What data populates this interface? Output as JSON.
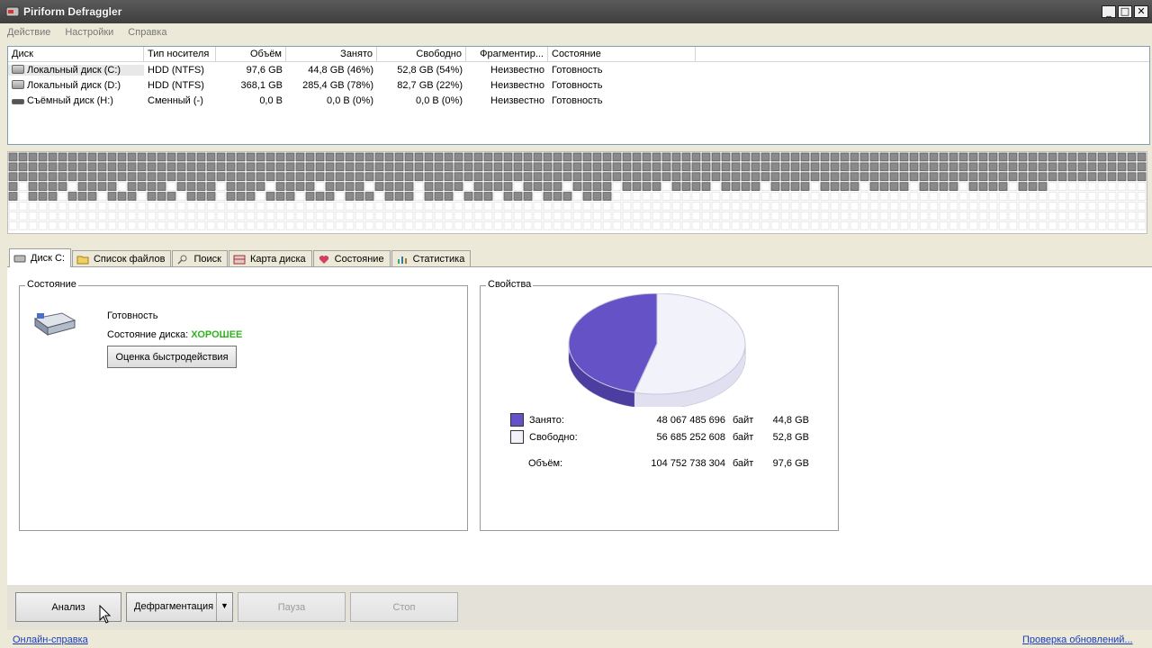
{
  "window": {
    "title": "Piriform Defraggler",
    "minimize": "_",
    "maximize": "□",
    "close": "✕"
  },
  "menu": [
    "Действие",
    "Настройки",
    "Справка"
  ],
  "drive_table": {
    "columns": [
      "Диск",
      "Тип носителя",
      "Объём",
      "Занято",
      "Свободно",
      "Фрагментир...",
      "Состояние"
    ],
    "rows": [
      {
        "icon": "hdd-icon",
        "name": "Локальный диск (C:)",
        "media": "HDD (NTFS)",
        "size": "97,6 GB",
        "used": "44,8 GB (46%)",
        "free": "52,8 GB (54%)",
        "frag": "Неизвестно",
        "state": "Готовность",
        "selected": true
      },
      {
        "icon": "hdd-icon",
        "name": "Локальный диск (D:)",
        "media": "HDD (NTFS)",
        "size": "368,1 GB",
        "used": "285,4 GB (78%)",
        "free": "82,7 GB (22%)",
        "frag": "Неизвестно",
        "state": "Готовность",
        "selected": false
      },
      {
        "icon": "removable-drive-icon",
        "name": "Съёмный диск (H:)",
        "media": "Сменный (-)",
        "size": "0,0 B",
        "used": "0,0 B (0%)",
        "free": "0,0 B (0%)",
        "frag": "Неизвестно",
        "state": "Готовность",
        "selected": false
      }
    ]
  },
  "tabs": [
    {
      "label": "Диск C:",
      "icon": "hdd-icon",
      "active": true
    },
    {
      "label": "Список файлов",
      "icon": "folder-icon",
      "active": false
    },
    {
      "label": "Поиск",
      "icon": "search-icon",
      "active": false
    },
    {
      "label": "Карта диска",
      "icon": "map-icon",
      "active": false
    },
    {
      "label": "Состояние",
      "icon": "health-icon",
      "active": false
    },
    {
      "label": "Статистика",
      "icon": "stats-icon",
      "active": false
    }
  ],
  "status_panel": {
    "legend": "Состояние",
    "ready": "Готовность",
    "health_label": "Состояние диска:",
    "health_value": "ХОРОШЕЕ",
    "benchmark_button": "Оценка быстродействия"
  },
  "properties_panel": {
    "legend": "Свойства",
    "used_label": "Занято:",
    "used_bytes": "48 067 485 696",
    "used_unit": "байт",
    "used_size": "44,8 GB",
    "free_label": "Свободно:",
    "free_bytes": "56 685 252 608",
    "free_unit": "байт",
    "free_size": "52,8 GB",
    "total_label": "Объём:",
    "total_bytes": "104 752 738 304",
    "total_unit": "байт",
    "total_size": "97,6 GB",
    "used_color": "#6452c6",
    "free_color": "#f2f2fb"
  },
  "chart_data": {
    "type": "pie",
    "categories": [
      "Занято",
      "Свободно"
    ],
    "values": [
      48067485696,
      56685252608
    ],
    "colors": [
      "#6452c6",
      "#f2f2fb"
    ]
  },
  "buttons": {
    "analyze": "Анализ",
    "defrag": "Дефрагментация",
    "pause": "Пауза",
    "stop": "Стоп"
  },
  "footer": {
    "help_link": "Онлайн-справка",
    "update_link": "Проверка обновлений..."
  },
  "block_map": {
    "used_color": "#8a8a8a",
    "free_color": "#ffffff",
    "fill_fraction": 0.46
  }
}
